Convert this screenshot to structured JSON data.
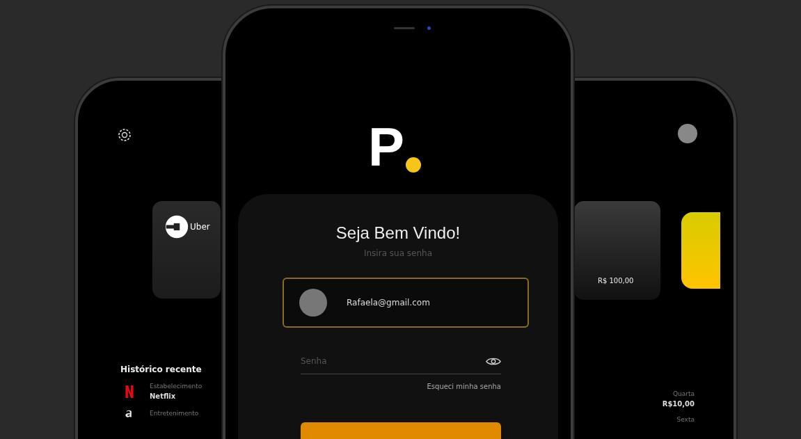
{
  "left_screen": {
    "card": {
      "brand": "Uber"
    },
    "history_title": "Histórico recente",
    "history": [
      {
        "kind": "netflix",
        "category": "Estabelecimento",
        "name": "Netflix"
      },
      {
        "kind": "amazon",
        "category": "Entretenimento"
      }
    ]
  },
  "login_screen": {
    "logo": "P",
    "title": "Seja Bem Vindo!",
    "subtitle": "Insira sua senha",
    "email": {
      "value": "Rafaela@gmail.com"
    },
    "password": {
      "placeholder": "Senha"
    },
    "forgot_link": "Esqueci minha senha"
  },
  "right_screen": {
    "card": {
      "amount": "R$ 100,00"
    },
    "transactions": [
      {
        "day": "Quarta",
        "amount": "R$10,00"
      },
      {
        "day": "Sexta"
      }
    ]
  }
}
